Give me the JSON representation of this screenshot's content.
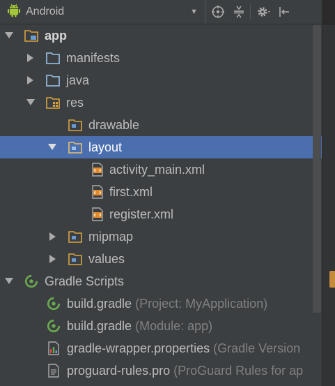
{
  "toolbar": {
    "view_label": "Android",
    "icons": [
      "android-icon",
      "chevron-down-icon",
      "locate-icon",
      "collapse-all-icon",
      "gear-icon",
      "hide-panel-icon"
    ]
  },
  "tree": {
    "app": "app",
    "manifests": "manifests",
    "java": "java",
    "res": "res",
    "drawable": "drawable",
    "layout": "layout",
    "activity_main": "activity_main.xml",
    "first": "first.xml",
    "register": "register.xml",
    "mipmap": "mipmap",
    "values": "values",
    "gradle_scripts": "Gradle Scripts",
    "build_gradle_project": {
      "name": "build.gradle",
      "hint": "(Project: MyApplication)"
    },
    "build_gradle_module": {
      "name": "build.gradle",
      "hint": "(Module: app)"
    },
    "gradle_wrapper": {
      "name": "gradle-wrapper.properties",
      "hint": "(Gradle Version"
    },
    "proguard": {
      "name": "proguard-rules.pro",
      "hint": "(ProGuard Rules for ap"
    }
  },
  "colors": {
    "background": "#3c3f41",
    "selection": "#4b6eaf",
    "text": "#bbbbbb",
    "hint": "#808080",
    "folder": "#8fb5d9",
    "android_green": "#a4c639",
    "gradle_green": "#6aa84f"
  }
}
